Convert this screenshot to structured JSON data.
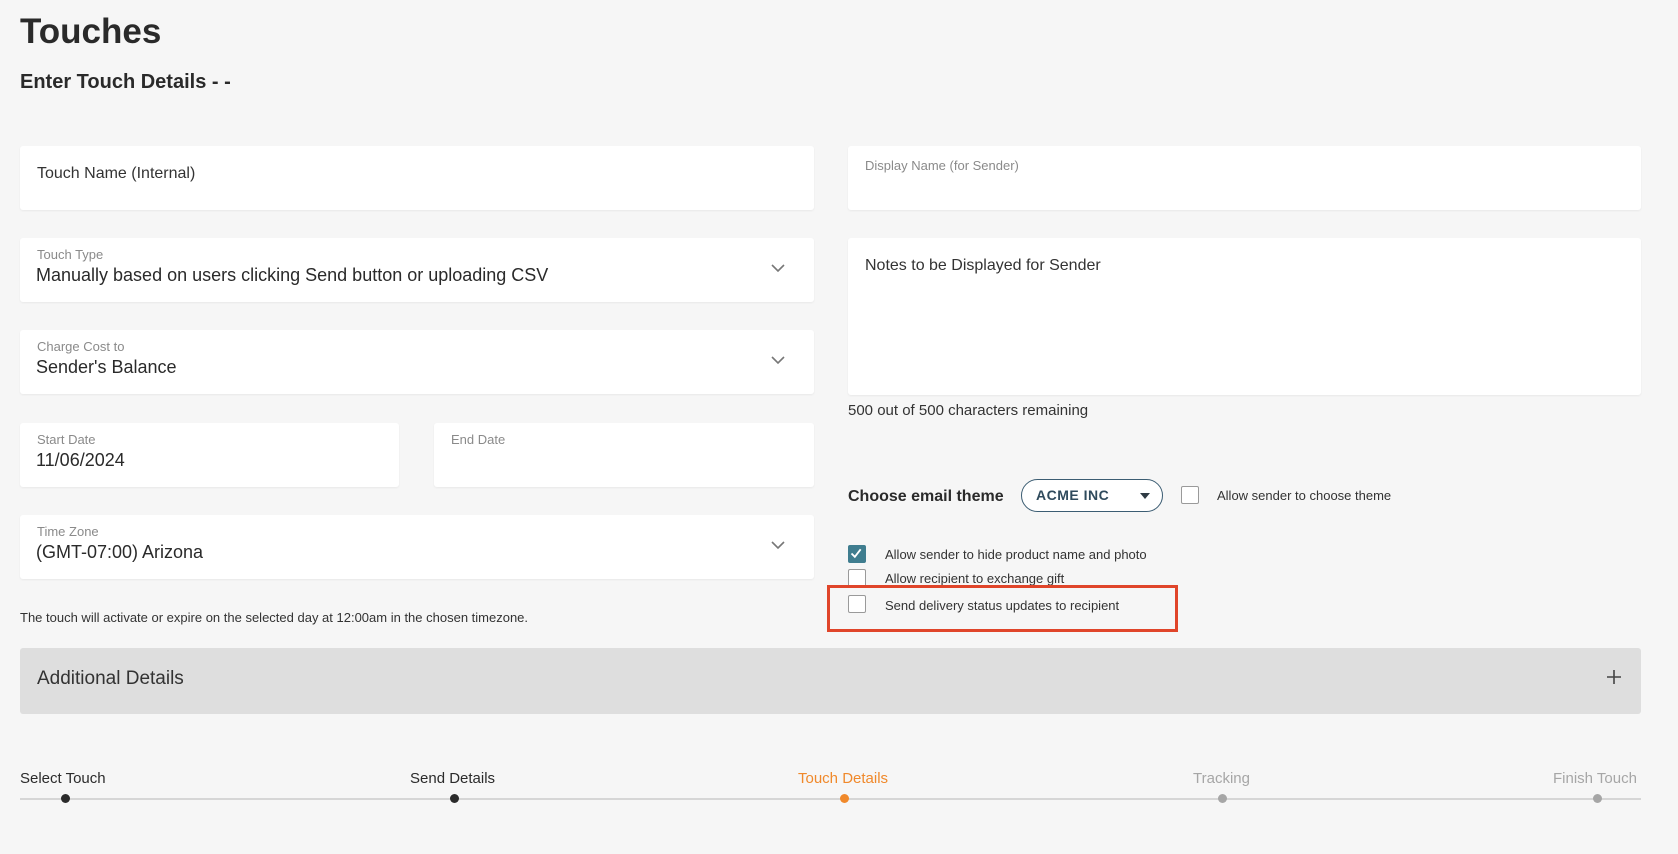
{
  "page": {
    "title": "Touches",
    "subtitle": "Enter Touch Details - -"
  },
  "form": {
    "touch_name": {
      "placeholder": "Touch Name (Internal)"
    },
    "display_name": {
      "label": "Display Name (for Sender)"
    },
    "touch_type": {
      "label": "Touch Type",
      "value": "Manually based on users clicking Send button or uploading CSV"
    },
    "notes": {
      "placeholder": "Notes to be Displayed for Sender",
      "counter": "500 out of 500 characters remaining"
    },
    "charge_cost": {
      "label": "Charge Cost to",
      "value": "Sender's Balance"
    },
    "start_date": {
      "label": "Start Date",
      "value": "11/06/2024"
    },
    "end_date": {
      "label": "End Date",
      "value": ""
    },
    "time_zone": {
      "label": "Time Zone",
      "value": "(GMT-07:00) Arizona"
    },
    "timezone_note": "The touch will activate or expire on the selected day at 12:00am in the chosen timezone.",
    "email_theme": {
      "label": "Choose email theme",
      "value": "ACME INC",
      "allow_choose_label": "Allow sender to choose theme",
      "allow_choose_checked": false
    },
    "options": [
      {
        "label": "Allow sender to hide product name and photo",
        "checked": true
      },
      {
        "label": "Allow recipient to exchange gift",
        "checked": false
      },
      {
        "label": "Send delivery status updates to recipient",
        "checked": false
      }
    ]
  },
  "accordion": {
    "label": "Additional Details"
  },
  "stepper": {
    "steps": [
      {
        "label": "Select Touch",
        "state": "done"
      },
      {
        "label": "Send Details",
        "state": "done"
      },
      {
        "label": "Touch Details",
        "state": "current"
      },
      {
        "label": "Tracking",
        "state": "upcoming"
      },
      {
        "label": "Finish Touch",
        "state": "upcoming"
      }
    ]
  },
  "colors": {
    "accent_orange": "#f0892b",
    "highlight_red": "#e0452a",
    "checkbox_teal": "#3f7d8f",
    "step_done": "#2b2b2b",
    "step_upcoming": "#a6a6a6"
  },
  "icons": {
    "dropdown": "chevron-down-icon",
    "expand": "plus-icon",
    "check": "check-icon"
  }
}
